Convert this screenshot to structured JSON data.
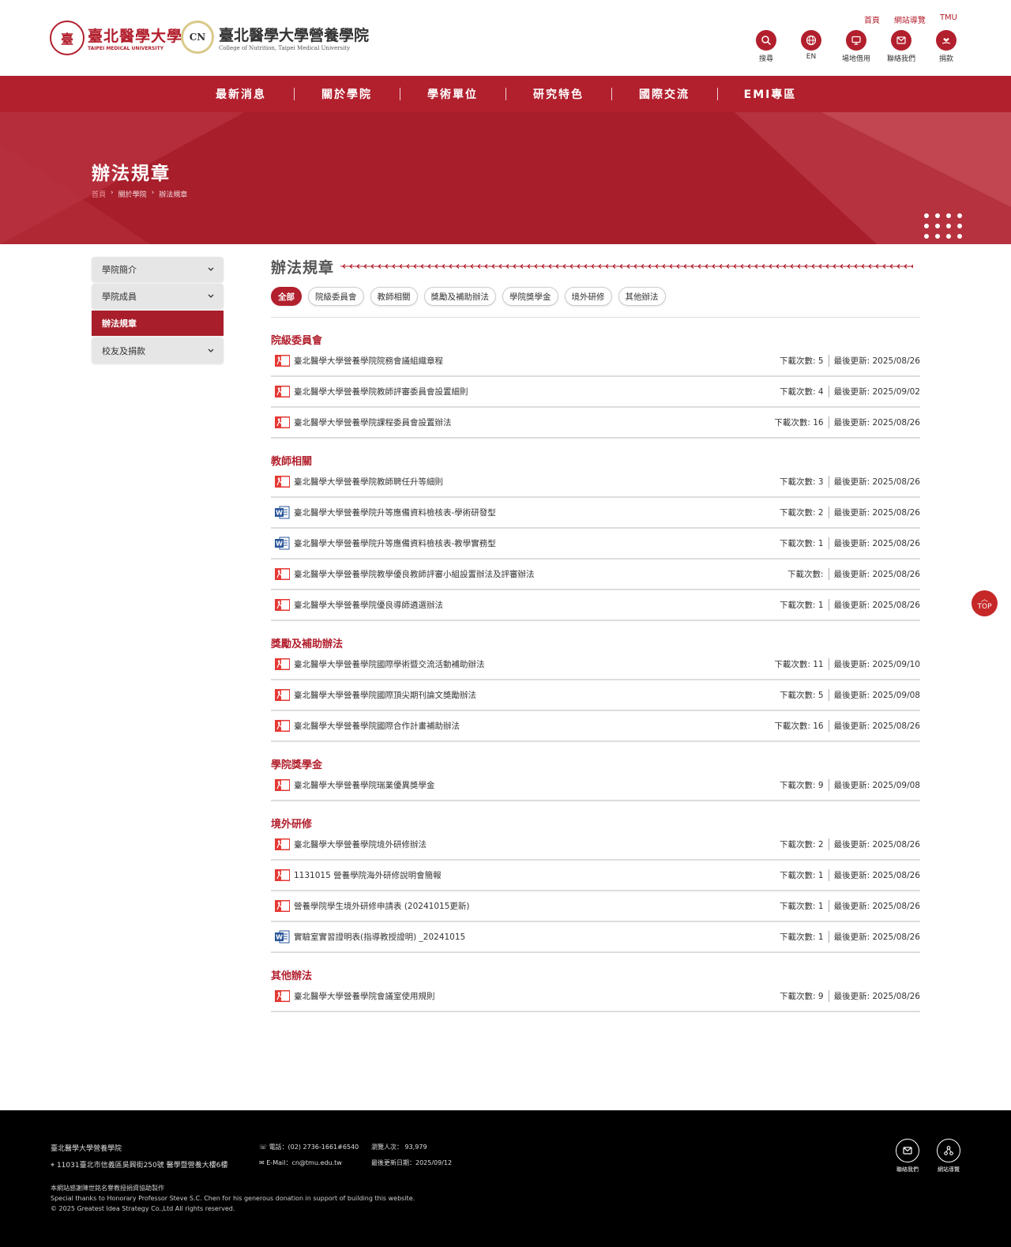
{
  "colors": {
    "brand": "#b21f2d",
    "banner": "#a81e2b",
    "footer": "#000000"
  },
  "logos": {
    "tmu_seal": "臺",
    "tmu_cn": "臺北醫學大學",
    "tmu_en": "TAIPEI MEDICAL UNIVERSITY",
    "college_badge": "CN",
    "college_cn": "臺北醫學大學營養學院",
    "college_en": "College of Nutrition, Taipei Medical University"
  },
  "top_links": [
    "首頁",
    "網站導覽",
    "TMU"
  ],
  "utility_icons": [
    {
      "label": "搜尋",
      "icon": "search-icon"
    },
    {
      "label": "EN",
      "icon": "globe-icon"
    },
    {
      "label": "場地借用",
      "icon": "monitor-icon"
    },
    {
      "label": "聯絡我們",
      "icon": "mail-icon"
    },
    {
      "label": "捐款",
      "icon": "donate-icon"
    }
  ],
  "nav": [
    "最新消息",
    "關於學院",
    "學術單位",
    "研究特色",
    "國際交流",
    "EMI專區"
  ],
  "banner": {
    "title": "辦法規章",
    "breadcrumb": [
      "首頁",
      "關於學院",
      "辦法規章"
    ],
    "sep": "›"
  },
  "sidebar": [
    {
      "label": "學院簡介",
      "has_chevron": true
    },
    {
      "label": "學院成員",
      "has_chevron": true
    },
    {
      "label": "辦法規章",
      "active": true
    },
    {
      "label": "校友及捐款",
      "has_chevron": true
    }
  ],
  "main": {
    "title": "辦法規章",
    "filters": [
      {
        "label": "全部",
        "active": true
      },
      {
        "label": "院級委員會"
      },
      {
        "label": "教師相關"
      },
      {
        "label": "獎勵及補助辦法"
      },
      {
        "label": "學院獎學金"
      },
      {
        "label": "境外研修"
      },
      {
        "label": "其他辦法"
      }
    ],
    "download_prefix": "下載次數:",
    "updated_prefix": "最後更新:",
    "sections": [
      {
        "title": "院級委員會",
        "files": [
          {
            "type": "pdf",
            "name": "臺北醫學大學營養學院院務會議組織章程",
            "downloads": "下載次數: 5",
            "updated": "最後更新: 2025/08/26"
          },
          {
            "type": "pdf",
            "name": "臺北醫學大學營養學院教師評審委員會設置細則",
            "downloads": "下載次數: 4",
            "updated": "最後更新: 2025/09/02"
          },
          {
            "type": "pdf",
            "name": "臺北醫學大學營養學院課程委員會設置辦法",
            "downloads": "下載次數: 16",
            "updated": "最後更新: 2025/08/26"
          }
        ]
      },
      {
        "title": "教師相關",
        "files": [
          {
            "type": "pdf",
            "name": "臺北醫學大學營養學院教師聘任升等細則",
            "downloads": "下載次數: 3",
            "updated": "最後更新: 2025/08/26"
          },
          {
            "type": "word",
            "name": "臺北醫學大學營養學院升等應備資料檢核表-學術研發型",
            "downloads": "下載次數: 2",
            "updated": "最後更新: 2025/08/26"
          },
          {
            "type": "word",
            "name": "臺北醫學大學營養學院升等應備資料檢核表-教學實務型",
            "downloads": "下載次數: 1",
            "updated": "最後更新: 2025/08/26"
          },
          {
            "type": "pdf",
            "name": "臺北醫學大學營養學院教學優良教師評審小組設置辦法及評審辦法",
            "downloads": "下載次數:",
            "updated": "最後更新: 2025/08/26"
          },
          {
            "type": "pdf",
            "name": "臺北醫學大學營養學院優良導師遴選辦法",
            "downloads": "下載次數: 1",
            "updated": "最後更新: 2025/08/26"
          }
        ]
      },
      {
        "title": "獎勵及補助辦法",
        "files": [
          {
            "type": "pdf",
            "name": "臺北醫學大學營養學院國際學術暨交流活動補助辦法",
            "downloads": "下載次數: 11",
            "updated": "最後更新: 2025/09/10"
          },
          {
            "type": "pdf",
            "name": "臺北醫學大學營養學院國際頂尖期刊論文獎勵辦法",
            "downloads": "下載次數: 5",
            "updated": "最後更新: 2025/09/08"
          },
          {
            "type": "pdf",
            "name": "臺北醫學大學營養學院國際合作計畫補助辦法",
            "downloads": "下載次數: 16",
            "updated": "最後更新: 2025/08/26"
          }
        ]
      },
      {
        "title": "學院獎學金",
        "files": [
          {
            "type": "pdf",
            "name": "臺北醫學大學營養學院瑞業優異獎學金",
            "downloads": "下載次數: 9",
            "updated": "最後更新: 2025/09/08"
          }
        ]
      },
      {
        "title": "境外研修",
        "files": [
          {
            "type": "pdf",
            "name": "臺北醫學大學營養學院境外研修辦法",
            "downloads": "下載次數: 2",
            "updated": "最後更新: 2025/08/26"
          },
          {
            "type": "pdf",
            "name": "1131015 營養學院海外研修說明會簡報",
            "downloads": "下載次數: 1",
            "updated": "最後更新: 2025/08/26"
          },
          {
            "type": "pdf",
            "name": "營養學院學生境外研修申請表 (20241015更新)",
            "downloads": "下載次數: 1",
            "updated": "最後更新: 2025/08/26"
          },
          {
            "type": "word",
            "name": "實驗室實習證明表(指導教授證明) _20241015",
            "downloads": "下載次數: 1",
            "updated": "最後更新: 2025/08/26"
          }
        ]
      },
      {
        "title": "其他辦法",
        "files": [
          {
            "type": "pdf",
            "name": "臺北醫學大學營養學院會議室使用規則",
            "downloads": "下載次數: 9",
            "updated": "最後更新: 2025/08/26"
          }
        ]
      }
    ]
  },
  "to_top": {
    "arrow": "︿",
    "label": "TOP"
  },
  "footer": {
    "name": "臺北醫學大學營養學院",
    "address": "11031臺北市信義區吳興街250號 醫學暨營養大樓6樓",
    "phone": "電話：(02) 2736-1661#6540",
    "email": "E-Mail：cn@tmu.edu.tw",
    "visitors": "瀏覽人次： 93,979",
    "last_updated": "最後更新日期：2025/09/12",
    "credit1": "本網站感謝陳世銘名譽教授捐資協助製作",
    "credit2": "Special thanks to Honorary Professor Steve S.C. Chen for his generous donation in support of building this website.",
    "copyright": "© 2025 Greatest Idea Strategy Co.,Ltd All rights reserved.",
    "icons": [
      {
        "label": "聯絡我們",
        "icon": "mail-icon"
      },
      {
        "label": "網站導覽",
        "icon": "sitemap-icon"
      }
    ]
  }
}
